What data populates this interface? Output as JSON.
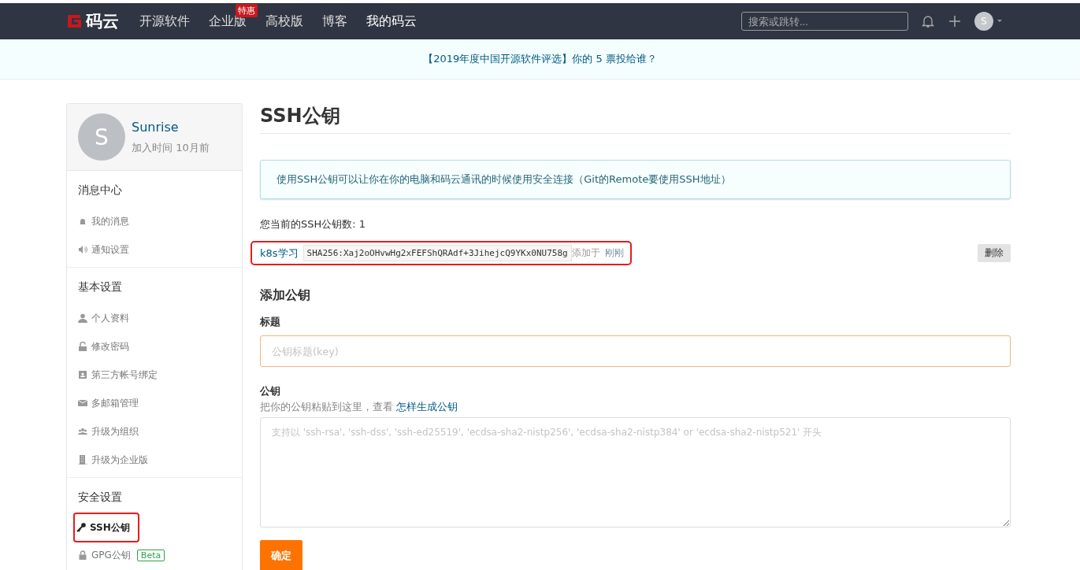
{
  "nav": {
    "logo": "码云",
    "links": [
      {
        "label": "开源软件",
        "selected": false
      },
      {
        "label": "企业版",
        "selected": false,
        "badge": "特惠"
      },
      {
        "label": "高校版",
        "selected": false
      },
      {
        "label": "博客",
        "selected": false
      },
      {
        "label": "我的码云",
        "selected": true
      }
    ],
    "search": {
      "placeholder": "搜索或跳转..."
    },
    "avatar": "S"
  },
  "banner": {
    "before": "【2019年度中国开源软件评选】你的 ",
    "count": "5",
    "after": " 票投给谁？"
  },
  "profile": {
    "avatar": "S",
    "name": "Sunrise",
    "joined": "加入时间 10月前"
  },
  "sidebar": [
    {
      "title": "消息中心",
      "items": [
        {
          "label": "我的消息",
          "selected": false,
          "highlighted": false
        },
        {
          "label": "通知设置",
          "selected": false,
          "highlighted": false
        }
      ]
    },
    {
      "title": "基本设置",
      "items": [
        {
          "label": "个人资料",
          "selected": false,
          "highlighted": false
        },
        {
          "label": "修改密码",
          "selected": false,
          "highlighted": false
        },
        {
          "label": "第三方帐号绑定",
          "selected": false,
          "highlighted": false
        },
        {
          "label": "多邮箱管理",
          "selected": false,
          "highlighted": false
        },
        {
          "label": "升级为组织",
          "selected": false,
          "highlighted": false
        },
        {
          "label": "升级为企业版",
          "selected": false,
          "highlighted": false
        }
      ]
    },
    {
      "title": "安全设置",
      "items": [
        {
          "label": "SSH公钥",
          "selected": true,
          "highlighted": true
        },
        {
          "label": "GPG公钥",
          "selected": false,
          "highlighted": false,
          "badge": "Beta"
        }
      ]
    }
  ],
  "page": {
    "title": "SSH公钥",
    "info": "使用SSH公钥可以让你在你的电脑和码云通讯的时候使用安全连接（Git的Remote要使用SSH地址）",
    "count_label": "您当前的SSH公钥数: 1",
    "keys": [
      {
        "name": "k8s学习",
        "fingerprint": "SHA256:Xaj2oOHvwHg2xFEFShQRAdf+3JihejcQ9YKx0NU758g",
        "added_label": "添加于",
        "added_time": "刚刚",
        "delete": "删除",
        "highlighted": true
      }
    ],
    "add": {
      "heading": "添加公钥",
      "title_label": "标题",
      "title_placeholder": "公钥标题(key)",
      "key_label": "公钥",
      "hint": "把你的公钥粘贴到这里，查看 ",
      "hint_link": "怎样生成公钥",
      "key_placeholder": "支持以 'ssh-rsa', 'ssh-dss', 'ssh-ed25519', 'ecdsa-sha2-nistp256', 'ecdsa-sha2-nistp384' or 'ecdsa-sha2-nistp521' 开头",
      "submit": "确定"
    }
  }
}
